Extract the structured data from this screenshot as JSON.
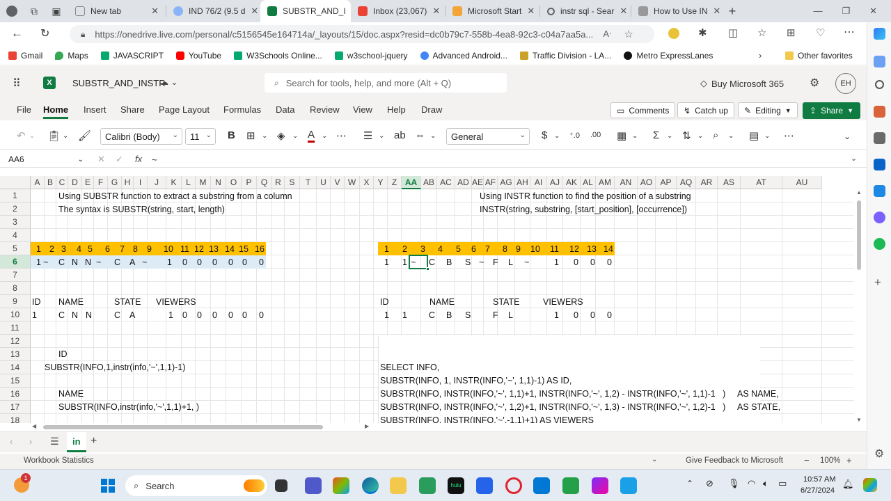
{
  "browser": {
    "tabs": [
      {
        "title": "New tab",
        "active": false
      },
      {
        "title": "IND 76/2 (9.5 d",
        "active": false
      },
      {
        "title": "SUBSTR_AND_I",
        "active": true
      },
      {
        "title": "Inbox (23,067)",
        "active": false
      },
      {
        "title": "Microsoft Start",
        "active": false
      },
      {
        "title": "instr sql - Sear",
        "active": false
      },
      {
        "title": "How to Use IN",
        "active": false
      }
    ],
    "url": "https://onedrive.live.com/personal/c5156545e164714a/_layouts/15/doc.aspx?resid=dc0b79c7-558b-4ea8-92c3-c04a7aa5a...",
    "bookmarks": [
      "Gmail",
      "Maps",
      "JAVASCRIPT",
      "YouTube",
      "W3Schools Online...",
      "w3school-jquery",
      "Advanced Android...",
      "Traffic Division - LA...",
      "Metro ExpressLanes"
    ],
    "other_favorites": "Other favorites",
    "profile_initials": "EH"
  },
  "excel": {
    "file_name": "SUBSTR_AND_INSTR",
    "search_placeholder": "Search for tools, help, and more (Alt + Q)",
    "buy_label": "Buy Microsoft 365",
    "ribbon_tabs": [
      "File",
      "Home",
      "Insert",
      "Share",
      "Page Layout",
      "Formulas",
      "Data",
      "Review",
      "View",
      "Help",
      "Draw"
    ],
    "comments_label": "Comments",
    "catchup_label": "Catch up",
    "editing_label": "Editing",
    "share_label": "Share",
    "font_name": "Calibri (Body)",
    "font_size": "11",
    "number_format": "General",
    "name_box": "AA6",
    "formula_value": "~",
    "fx_label": "fx",
    "columns": [
      "A",
      "B",
      "C",
      "D",
      "E",
      "F",
      "G",
      "H",
      "I",
      "J",
      "K",
      "L",
      "M",
      "N",
      "O",
      "P",
      "Q",
      "R",
      "S",
      "T",
      "U",
      "V",
      "W",
      "X",
      "Y",
      "Z",
      "AA",
      "AB",
      "AC",
      "AD",
      "AE",
      "AF",
      "AG",
      "AH",
      "AI",
      "AJ",
      "AK",
      "AL",
      "AM",
      "AN",
      "AO",
      "AP",
      "AQ",
      "AR",
      "AS",
      "AT",
      "AU"
    ],
    "rows": [
      "1",
      "2",
      "3",
      "4",
      "5",
      "6",
      "7",
      "8",
      "9",
      "10",
      "11",
      "12",
      "13",
      "14",
      "15",
      "16",
      "17",
      "18"
    ],
    "cells": {
      "l_r1": "Using SUBSTR function to extract a substring from a column",
      "l_r2": "The syntax is SUBSTR(string, start, length)",
      "l_r5": [
        "1",
        "2",
        "3",
        "4",
        "5",
        "6",
        "7",
        "8",
        "9",
        "10",
        "11",
        "12",
        "13",
        "14",
        "15",
        "16"
      ],
      "l_r6": [
        "1",
        "~",
        "C",
        "N",
        "N",
        "~",
        "C",
        "A",
        "~",
        "1",
        "0",
        "0",
        "0",
        "0",
        "0",
        "0"
      ],
      "l_r9": [
        "ID",
        "NAME",
        "STATE",
        "VIEWERS"
      ],
      "l_r10": [
        "1",
        "C",
        "N",
        "N",
        "C",
        "A",
        "1",
        "0",
        "0",
        "0",
        "0",
        "0",
        "0"
      ],
      "l_r13": "ID",
      "l_r14": "SUBSTR(INFO,1,instr(info,'~',1,1)-1)",
      "l_r16": "NAME",
      "l_r17": "SUBSTR(INFO,instr(info,'~',1,1)+1,   )",
      "r_r1": "Using INSTR function to find the position of a substring",
      "r_r2": "INSTR(string, substring, [start_position], [occurrence])",
      "r_r5": [
        "1",
        "2",
        "3",
        "4",
        "5",
        "6",
        "7",
        "8",
        "9",
        "10",
        "11",
        "12",
        "13",
        "14"
      ],
      "r_r6": [
        "1",
        "1",
        "~",
        "C",
        "B",
        "S",
        "~",
        "F",
        "L",
        "~",
        "1",
        "0",
        "0",
        "0"
      ],
      "r_r9": [
        "ID",
        "NAME",
        "STATE",
        "VIEWERS"
      ],
      "r_r10": [
        "1",
        "1",
        "C",
        "B",
        "S",
        "F",
        "L",
        "1",
        "0",
        "0",
        "0"
      ],
      "r_r14": "SELECT INFO,",
      "r_r15": "SUBSTR(INFO, 1, INSTR(INFO,'~', 1,1)-1) AS ID,",
      "r_r16": "SUBSTR(INFO, INSTR(INFO,'~', 1,1)+1, INSTR(INFO,'~', 1,2) - INSTR(INFO,'~', 1,1)-1   )     AS NAME,",
      "r_r17": "SUBSTR(INFO, INSTR(INFO,'~', 1,2)+1, INSTR(INFO,'~', 1,3) - INSTR(INFO,'~', 1,2)-1   )     AS STATE,",
      "r_r18": "SUBSTR(INFO, INSTR(INFO,'~',-1,1)+1) AS VIEWERS"
    },
    "sheet_tab": "in",
    "status_left": "Workbook Statistics",
    "feedback": "Give Feedback to Microsoft",
    "zoom": "100%"
  },
  "taskbar": {
    "search_label": "Search",
    "time": "10:57 AM",
    "date": "6/27/2024",
    "weather_badge": "1"
  },
  "colors": {
    "excel_green": "#107c41",
    "header_yellow": "#ffc000",
    "row6_blue": "#ddebf7"
  }
}
